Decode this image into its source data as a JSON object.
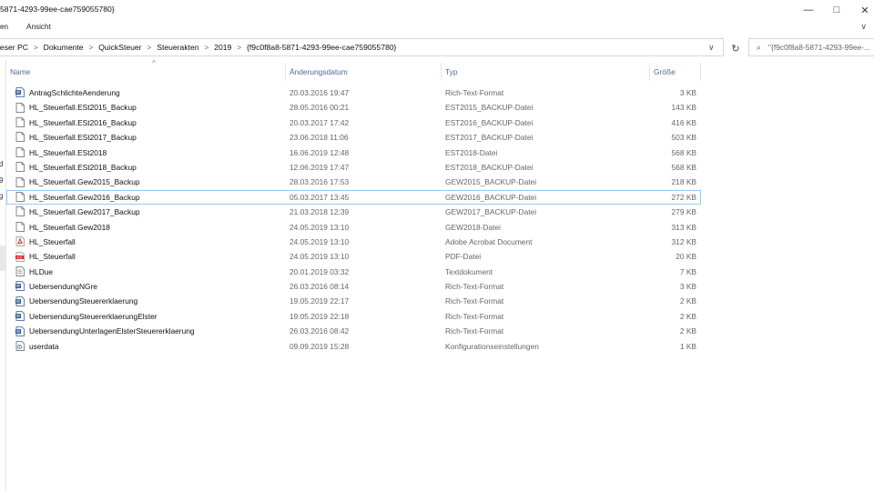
{
  "window": {
    "title": "5871-4293-99ee-cae759055780}",
    "controls": {
      "minimize": "—",
      "maximize": "□",
      "close": "✕"
    }
  },
  "menu": {
    "items": [
      "en",
      "Ansicht"
    ]
  },
  "address": {
    "crumbs": [
      "ieser PC",
      "Dokumente",
      "QuickSteuer",
      "Steuerakten",
      "2019",
      "{f9c0f8a8-5871-4293-99ee-cae759055780}"
    ]
  },
  "search": {
    "text": "\"{f9c0f8a8-5871-4293-99ee-..."
  },
  "nav": {
    "fragments": [
      "d",
      "9",
      "g"
    ]
  },
  "columns": {
    "name": "Name",
    "date": "Änderungsdatum",
    "type": "Typ",
    "size": "Größe"
  },
  "files": [
    {
      "name": "AntragSchlichteAenderung",
      "date": "20.03.2016 19:47",
      "type": "Rich-Text-Format",
      "size": "3 KB",
      "icon": "rtf-icon"
    },
    {
      "name": "HL_Steuerfall.ESt2015_Backup",
      "date": "28.05.2016 00:21",
      "type": "EST2015_BACKUP-Datei",
      "size": "143 KB",
      "icon": "file-icon"
    },
    {
      "name": "HL_Steuerfall.ESt2016_Backup",
      "date": "20.03.2017 17:42",
      "type": "EST2016_BACKUP-Datei",
      "size": "416 KB",
      "icon": "file-icon"
    },
    {
      "name": "HL_Steuerfall.ESt2017_Backup",
      "date": "23.06.2018 11:06",
      "type": "EST2017_BACKUP-Datei",
      "size": "503 KB",
      "icon": "file-icon"
    },
    {
      "name": "HL_Steuerfall.ESt2018",
      "date": "16.06.2019 12:48",
      "type": "EST2018-Datei",
      "size": "568 KB",
      "icon": "file-icon"
    },
    {
      "name": "HL_Steuerfall.ESt2018_Backup",
      "date": "12.06.2019 17:47",
      "type": "EST2018_BACKUP-Datei",
      "size": "568 KB",
      "icon": "file-icon"
    },
    {
      "name": "HL_Steuerfall.Gew2015_Backup",
      "date": "28.03.2016 17:53",
      "type": "GEW2015_BACKUP-Datei",
      "size": "218 KB",
      "icon": "file-icon"
    },
    {
      "name": "HL_Steuerfall.Gew2016_Backup",
      "date": "05.03.2017 13:45",
      "type": "GEW2016_BACKUP-Datei",
      "size": "272 KB",
      "icon": "file-icon",
      "selected": true
    },
    {
      "name": "HL_Steuerfall.Gew2017_Backup",
      "date": "21.03.2018 12:39",
      "type": "GEW2017_BACKUP-Datei",
      "size": "279 KB",
      "icon": "file-icon"
    },
    {
      "name": "HL_Steuerfall.Gew2018",
      "date": "24.05.2019 13:10",
      "type": "GEW2018-Datei",
      "size": "313 KB",
      "icon": "file-icon"
    },
    {
      "name": "HL_Steuerfall",
      "date": "24.05.2019 13:10",
      "type": "Adobe Acrobat Document",
      "size": "312 KB",
      "icon": "acrobat-icon"
    },
    {
      "name": "HL_Steuerfall",
      "date": "24.05.2019 13:10",
      "type": "PDF-Datei",
      "size": "20 KB",
      "icon": "pdf-icon"
    },
    {
      "name": "HLDue",
      "date": "20.01.2019 03:32",
      "type": "Textdokument",
      "size": "7 KB",
      "icon": "text-icon"
    },
    {
      "name": "UebersendungNGre",
      "date": "26.03.2016 08:14",
      "type": "Rich-Text-Format",
      "size": "3 KB",
      "icon": "rtf-icon"
    },
    {
      "name": "UebersendungSteuererklaerung",
      "date": "19.05.2019 22:17",
      "type": "Rich-Text-Format",
      "size": "2 KB",
      "icon": "rtf-icon"
    },
    {
      "name": "UebersendungSteuererklaerungElster",
      "date": "19.05.2019 22:18",
      "type": "Rich-Text-Format",
      "size": "2 KB",
      "icon": "rtf-icon"
    },
    {
      "name": "UebersendungUnterlagenElsterSteuererklaerung",
      "date": "26.03.2016 08:42",
      "type": "Rich-Text-Format",
      "size": "2 KB",
      "icon": "rtf-icon"
    },
    {
      "name": "userdata",
      "date": "09.09.2019 15:28",
      "type": "Konfigurationseinstellungen",
      "size": "1 KB",
      "icon": "settings-file-icon"
    }
  ]
}
